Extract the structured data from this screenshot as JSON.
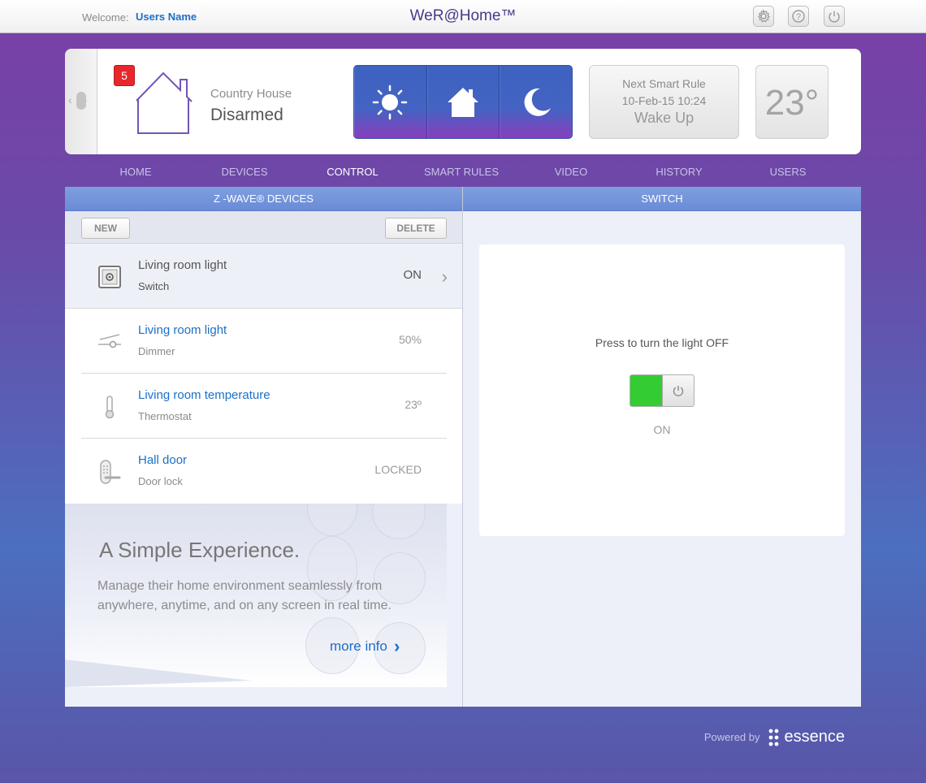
{
  "header": {
    "welcome_label": "Welcome:",
    "user_name": "Users Name",
    "app_title": "WeR@Home™"
  },
  "status": {
    "alert_count": "5",
    "site_name": "Country House",
    "site_state": "Disarmed",
    "modes": [
      "day-mode",
      "home-mode",
      "night-mode"
    ],
    "next_rule": {
      "label": "Next Smart Rule",
      "datetime": "10-Feb-15 10:24",
      "name": "Wake Up"
    },
    "temperature": "23°"
  },
  "nav": {
    "tabs": [
      "HOME",
      "DEVICES",
      "CONTROL",
      "SMART RULES",
      "VIDEO",
      "HISTORY",
      "USERS"
    ],
    "active": "CONTROL"
  },
  "devices_panel": {
    "header": "Z -WAVE®  DEVICES",
    "new_label": "NEW",
    "delete_label": "DELETE",
    "devices": [
      {
        "name": "Living room light",
        "type": "Switch",
        "value": "ON",
        "icon": "switch-icon"
      },
      {
        "name": "Living room light",
        "type": "Dimmer",
        "value": "50%",
        "icon": "dimmer-icon"
      },
      {
        "name": "Living room temperature",
        "type": "Thermostat",
        "value": "23º",
        "icon": "thermometer-icon"
      },
      {
        "name": "Hall door",
        "type": "Door lock",
        "value": "LOCKED",
        "icon": "door-lock-icon"
      }
    ]
  },
  "promo": {
    "title": "A Simple Experience.",
    "description": "Manage their home environment seamlessly from anywhere, anytime, and on any screen in real time.",
    "more_label": "more info"
  },
  "switch_panel": {
    "header": "SWITCH",
    "prompt": "Press to turn the light  OFF",
    "state": "ON",
    "colors": {
      "on": "#33cc33"
    }
  },
  "footer": {
    "powered_by": "Powered by",
    "brand": "essence"
  }
}
